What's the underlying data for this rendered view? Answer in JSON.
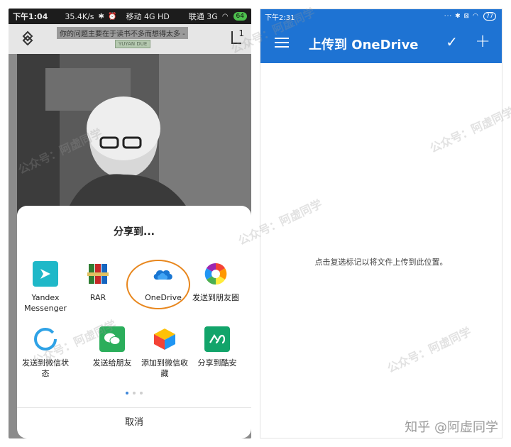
{
  "left": {
    "status": {
      "time": "下午1:04",
      "speed": "35.4K/s",
      "network": "移动 4G HD",
      "carrier2": "联通 3G",
      "battery": "64"
    },
    "top": {
      "message": "你的问题主要在于读书不多而想得太多 -",
      "subtitle": "YUYAN DUE",
      "page_num": "1"
    },
    "share_sheet": {
      "title": "分享到...",
      "apps": [
        {
          "label": "Yandex\nMessenger",
          "icon": "yandex-messenger-icon"
        },
        {
          "label": "RAR",
          "icon": "rar-icon"
        },
        {
          "label": "OneDrive",
          "icon": "onedrive-icon"
        },
        {
          "label": "发送到朋友圈",
          "icon": "wechat-moments-icon"
        },
        {
          "label": "发送到微信状\n态",
          "icon": "wechat-status-icon"
        },
        {
          "label": "发送给朋友",
          "icon": "wechat-friend-icon"
        },
        {
          "label": "添加到微信收\n藏",
          "icon": "wechat-favorite-icon"
        },
        {
          "label": "分享到酷安",
          "icon": "coolapk-icon"
        }
      ],
      "cancel": "取消"
    }
  },
  "right": {
    "status": {
      "time": "下午2:31",
      "battery": "77"
    },
    "app_bar": {
      "title": "上传到 OneDrive"
    },
    "hint": "点击复选标记以将文件上传到此位置。"
  },
  "watermark": {
    "text": "公众号：阿虚同学",
    "credit": "知乎 @阿虚同学"
  },
  "colors": {
    "accent_blue": "#1e73d3",
    "highlight": "#e8871e"
  }
}
